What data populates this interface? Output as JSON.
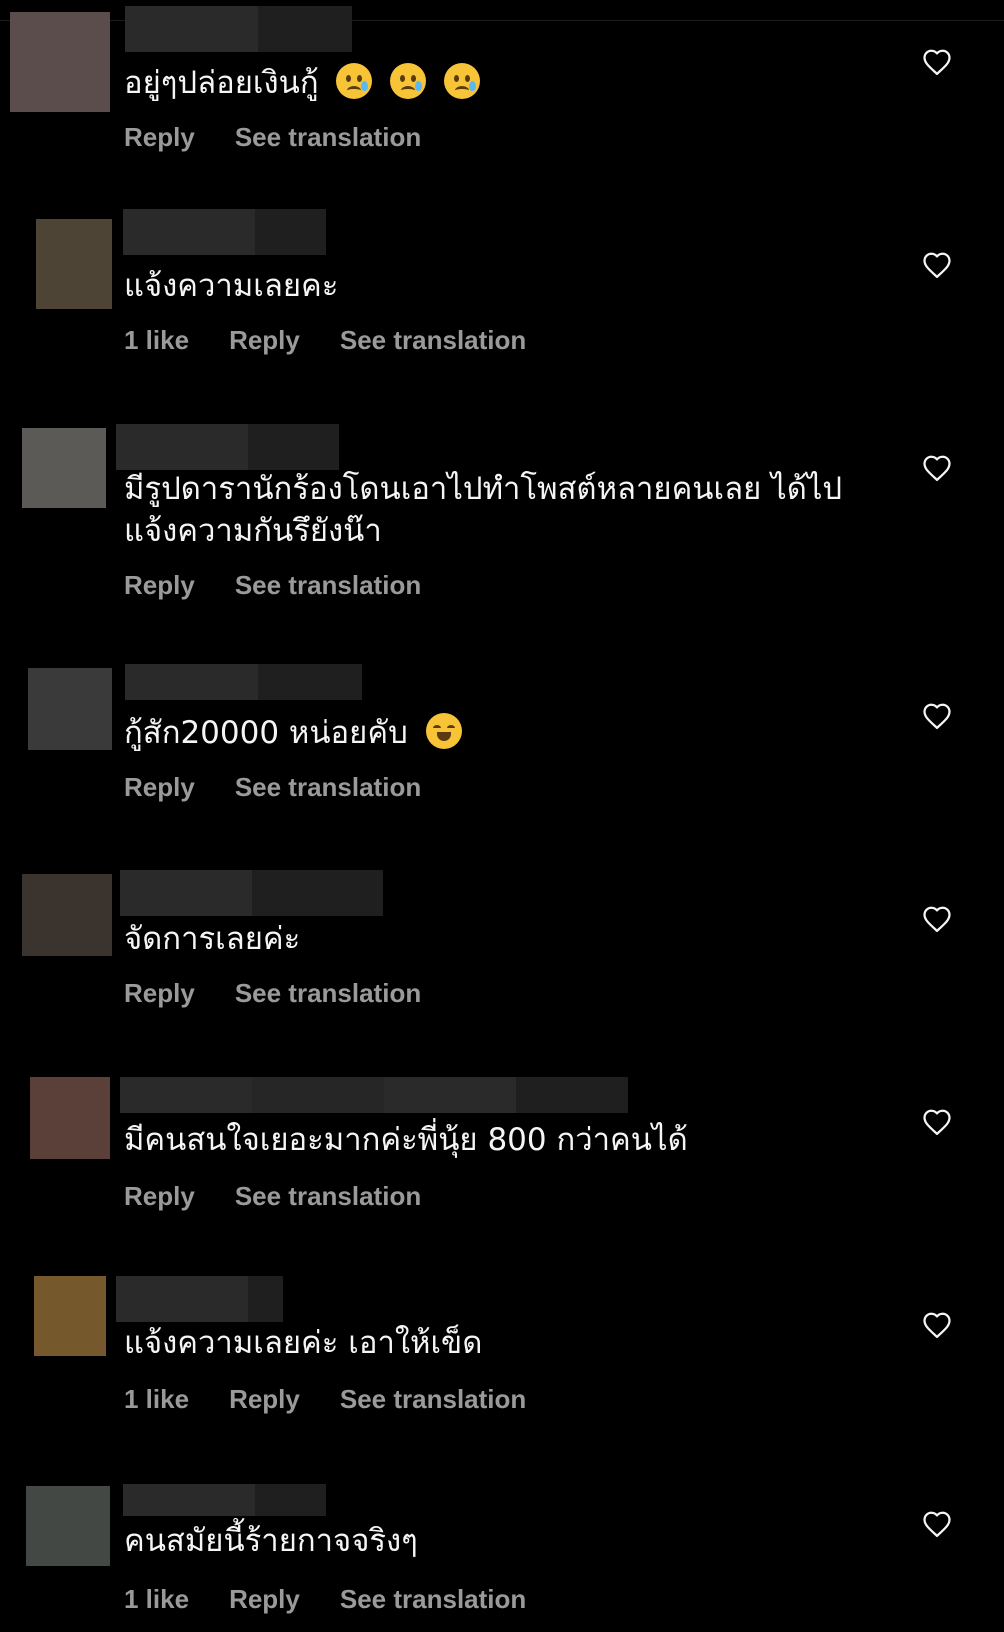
{
  "colors": {
    "background": "#000000",
    "text": "#f5f5f5",
    "meta_text": "#9a9a9a",
    "redaction_dark": "#1f1f1f",
    "redaction_mid": "#2a2a2a"
  },
  "icons": {
    "like": "heart-outline-icon",
    "crying": "crying-face-emoji",
    "laughing": "grinning-squinting-face-emoji"
  },
  "comments": [
    {
      "text": "อยู่ๆปล่อยเงินกู้",
      "emoji_count": 3,
      "likes": "",
      "reply": "Reply",
      "translate": "See translation"
    },
    {
      "text": "แจ้งความเลยคะ",
      "likes": "1 like",
      "reply": "Reply",
      "translate": "See translation"
    },
    {
      "text": "มีรูปดารานักร้องโดนเอาไปทำโพสต์หลายคนเลย  ได้ไปแจ้งความกันรึยังน๊า",
      "likes": "",
      "reply": "Reply",
      "translate": "See translation"
    },
    {
      "text": "กู้สัก20000 หน่อยคับ",
      "likes": "",
      "reply": "Reply",
      "translate": "See translation"
    },
    {
      "text": "จัดการเลยค่ะ",
      "likes": "",
      "reply": "Reply",
      "translate": "See translation"
    },
    {
      "text": "มีคนสนใจเยอะมากค่ะพี่นุ้ย 800 กว่าคนได้",
      "likes": "",
      "reply": "Reply",
      "translate": "See translation"
    },
    {
      "text": "แจ้งความเลยค่ะ เอาให้เข็ด",
      "likes": "1 like",
      "reply": "Reply",
      "translate": "See translation"
    },
    {
      "text": "คนสมัยนี้ร้ายกาจจริงๆ",
      "likes": "1 like",
      "reply": "Reply",
      "translate": "See translation"
    }
  ]
}
